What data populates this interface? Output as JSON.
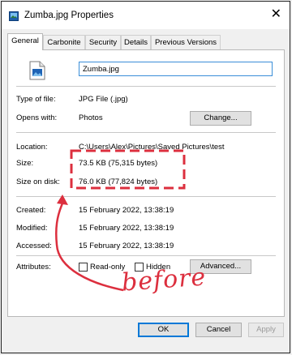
{
  "window": {
    "title": "Zumba.jpg Properties",
    "close_glyph": "✕"
  },
  "tabs": [
    {
      "label": "General",
      "active": true
    },
    {
      "label": "Carbonite",
      "active": false
    },
    {
      "label": "Security",
      "active": false
    },
    {
      "label": "Details",
      "active": false
    },
    {
      "label": "Previous Versions",
      "active": false
    }
  ],
  "general": {
    "file_name": "Zumba.jpg",
    "type_label": "Type of file:",
    "type_value": "JPG File (.jpg)",
    "opens_label": "Opens with:",
    "opens_value": "Photos",
    "change_button": "Change...",
    "location_label": "Location:",
    "location_value": "C:\\Users\\Alex\\Pictures\\Saved Pictures\\test",
    "size_label": "Size:",
    "size_value": "73.5 KB (75,315 bytes)",
    "size_disk_label": "Size on disk:",
    "size_disk_value": "76.0 KB (77,824 bytes)",
    "created_label": "Created:",
    "created_value": "15 February 2022, 13:38:19",
    "modified_label": "Modified:",
    "modified_value": "15 February 2022, 13:38:19",
    "accessed_label": "Accessed:",
    "accessed_value": "15 February 2022, 13:38:19",
    "attributes_label": "Attributes:",
    "readonly_label": "Read-only",
    "hidden_label": "Hidden",
    "advanced_button": "Advanced..."
  },
  "footer": {
    "ok": "OK",
    "cancel": "Cancel",
    "apply": "Apply"
  },
  "annotation": {
    "text": "before",
    "color": "#dc2f3e"
  },
  "icons": {
    "app": "image-file-icon",
    "file": "image-file-icon",
    "close": "close-icon"
  }
}
